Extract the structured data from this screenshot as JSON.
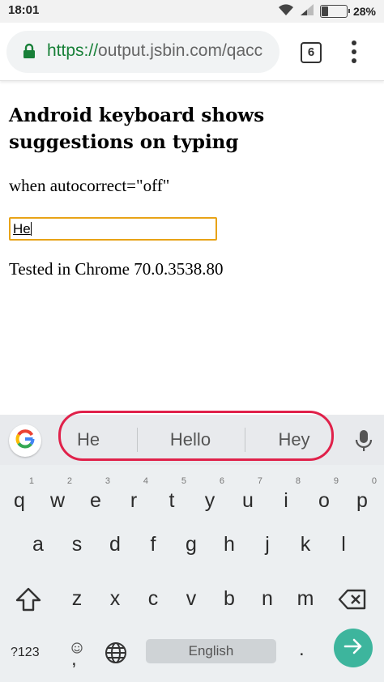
{
  "status_bar": {
    "time": "18:01",
    "battery_percent": "28%",
    "battery_level": 0.28,
    "icons": [
      "wifi-icon",
      "signal-icon",
      "battery-icon"
    ]
  },
  "browser": {
    "url_scheme": "https://",
    "url_rest": "output.jsbin.com/qacc",
    "tab_count": "6",
    "secure_color": "#188038"
  },
  "page": {
    "heading": "Android keyboard shows suggestions on typing",
    "subtitle": "when autocorrect=\"off\"",
    "input_value": "He",
    "input_border_color": "#e8a317",
    "tested_text": "Tested in Chrome 70.0.3538.80"
  },
  "keyboard": {
    "suggestions": [
      "He",
      "Hello",
      "Hey"
    ],
    "highlight_color": "#e0214a",
    "row1": [
      {
        "key": "q",
        "hint": "1"
      },
      {
        "key": "w",
        "hint": "2"
      },
      {
        "key": "e",
        "hint": "3"
      },
      {
        "key": "r",
        "hint": "4"
      },
      {
        "key": "t",
        "hint": "5"
      },
      {
        "key": "y",
        "hint": "6"
      },
      {
        "key": "u",
        "hint": "7"
      },
      {
        "key": "i",
        "hint": "8"
      },
      {
        "key": "o",
        "hint": "9"
      },
      {
        "key": "p",
        "hint": "0"
      }
    ],
    "row2": [
      "a",
      "s",
      "d",
      "f",
      "g",
      "h",
      "j",
      "k",
      "l"
    ],
    "row3": [
      "z",
      "x",
      "c",
      "v",
      "b",
      "n",
      "m"
    ],
    "symbols_label": "?123",
    "comma": ",",
    "space_label": "English",
    "period": ".",
    "enter_color": "#3db59d"
  }
}
